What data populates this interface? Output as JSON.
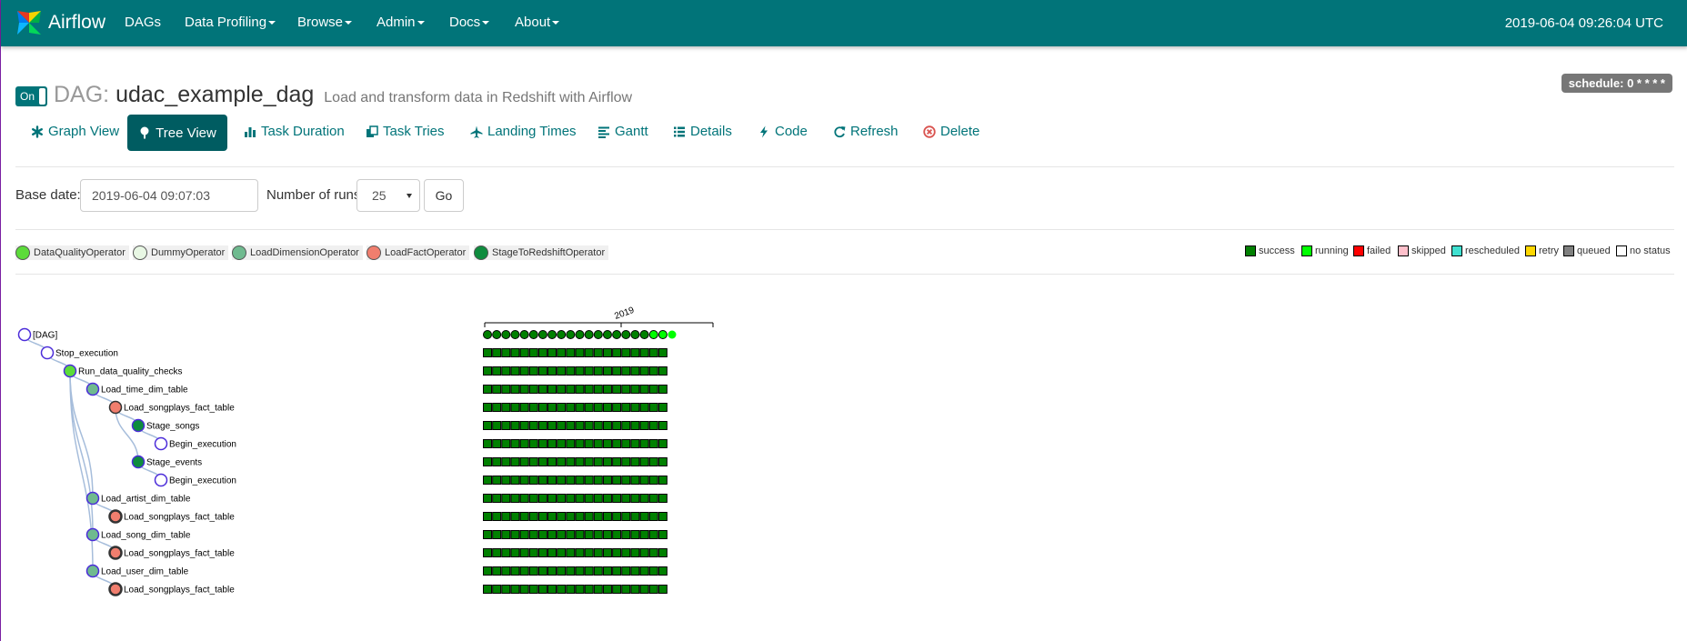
{
  "navbar": {
    "brand": "Airflow",
    "items": [
      "DAGs",
      "Data Profiling",
      "Browse",
      "Admin",
      "Docs",
      "About"
    ],
    "clock": "2019-06-04 09:26:04 UTC"
  },
  "dag": {
    "toggle_label": "On",
    "prefix": "DAG:",
    "id": "udac_example_dag",
    "description": "Load and transform data in Redshift with Airflow",
    "schedule": "schedule: 0 * * * *"
  },
  "tabs": [
    {
      "label": "Graph View",
      "icon": "asterisk-icon"
    },
    {
      "label": "Tree View",
      "icon": "tree-icon",
      "active": true
    },
    {
      "label": "Task Duration",
      "icon": "bar-chart-icon"
    },
    {
      "label": "Task Tries",
      "icon": "duplicate-icon"
    },
    {
      "label": "Landing Times",
      "icon": "plane-icon"
    },
    {
      "label": "Gantt",
      "icon": "align-left-icon"
    },
    {
      "label": "Details",
      "icon": "list-icon"
    },
    {
      "label": "Code",
      "icon": "flash-icon"
    },
    {
      "label": "Refresh",
      "icon": "refresh-icon"
    },
    {
      "label": "Delete",
      "icon": "remove-circle-icon"
    }
  ],
  "form": {
    "base_date_label": "Base date:",
    "base_date_value": "2019-06-04 09:07:03",
    "runs_label": "Number of runs:",
    "runs_value": "25",
    "go_label": "Go"
  },
  "operator_legend": [
    {
      "name": "DataQualityOperator",
      "color": "#5cdb3a"
    },
    {
      "name": "DummyOperator",
      "color": "#e8f7e4"
    },
    {
      "name": "LoadDimensionOperator",
      "color": "#6fba8f"
    },
    {
      "name": "LoadFactOperator",
      "color": "#f07e6e"
    },
    {
      "name": "StageToRedshiftOperator",
      "color": "#0f8c3e"
    }
  ],
  "state_legend": [
    {
      "name": "success",
      "color": "#008000"
    },
    {
      "name": "running",
      "color": "#00ff00"
    },
    {
      "name": "failed",
      "color": "#ff0000"
    },
    {
      "name": "skipped",
      "color": "#ffc0cb"
    },
    {
      "name": "rescheduled",
      "color": "#40e0d0"
    },
    {
      "name": "retry",
      "color": "#ffd700"
    },
    {
      "name": "queued",
      "color": "#808080"
    },
    {
      "name": "no status",
      "color": "#ffffff"
    }
  ],
  "timeline_label": "2019",
  "tree": [
    {
      "label": "[DAG]",
      "depth": 0,
      "color": "#ffffff",
      "tail": "dag"
    },
    {
      "label": "Stop_execution",
      "depth": 1,
      "color": "#ffffff",
      "tail": "GGNNN"
    },
    {
      "label": "Run_data_quality_checks",
      "depth": 2,
      "color": "#5cdb3a",
      "tail": "GGNNN"
    },
    {
      "label": "Load_time_dim_table",
      "depth": 3,
      "color": "#6fba8f",
      "tail": "GGLQQ"
    },
    {
      "label": "Load_songplays_fact_table",
      "depth": 4,
      "color": "#f07e6e",
      "tail": "GGGGG"
    },
    {
      "label": "Stage_songs",
      "depth": 5,
      "color": "#0f8c3e",
      "tail": "GGGGG"
    },
    {
      "label": "Begin_execution",
      "depth": 6,
      "color": "#ffffff",
      "tail": "GGGGG"
    },
    {
      "label": "Stage_events",
      "depth": 5,
      "color": "#0f8c3e",
      "tail": "GGGGG"
    },
    {
      "label": "Begin_execution",
      "depth": 6,
      "color": "#ffffff",
      "tail": "GGGGG"
    },
    {
      "label": "Load_artist_dim_table",
      "depth": 3,
      "color": "#6fba8f",
      "tail": "GGLQQ"
    },
    {
      "label": "Load_songplays_fact_table",
      "depth": 4,
      "color": "#f07e6e",
      "tail": "GGGGG"
    },
    {
      "label": "Load_song_dim_table",
      "depth": 3,
      "color": "#6fba8f",
      "tail": "GGLQQ"
    },
    {
      "label": "Load_songplays_fact_table",
      "depth": 4,
      "color": "#f07e6e",
      "tail": "GGGGG"
    },
    {
      "label": "Load_user_dim_table",
      "depth": 3,
      "color": "#6fba8f",
      "tail": "GGLQQ"
    },
    {
      "label": "Load_songplays_fact_table",
      "depth": 4,
      "color": "#f07e6e",
      "tail": "GGGGG"
    }
  ]
}
